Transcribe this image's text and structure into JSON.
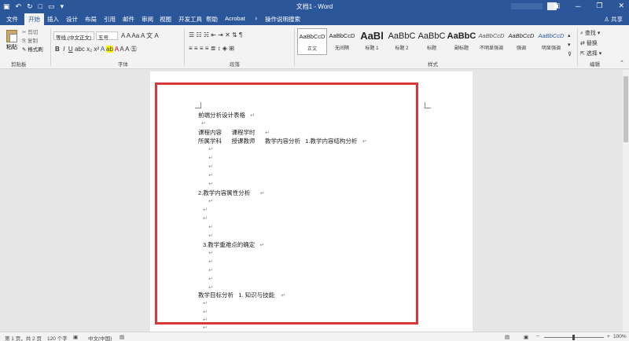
{
  "title_bar": {
    "doc_title": "文档1 - Word"
  },
  "tabs": [
    "文件",
    "开始",
    "插入",
    "设计",
    "布局",
    "引用",
    "邮件",
    "审阅",
    "视图",
    "开发工具",
    "帮助",
    "Acrobat"
  ],
  "tell_me": "操作说明搜索",
  "share": "共享",
  "ribbon": {
    "clipboard": {
      "paste": "粘贴",
      "cut": "剪切",
      "copy": "复制",
      "painter": "格式刷",
      "label": "剪贴板"
    },
    "font": {
      "family": "等线 (中文正文)",
      "size": "五号",
      "label": "字体"
    },
    "paragraph": {
      "label": "段落"
    },
    "styles": {
      "label": "样式",
      "items": [
        {
          "sample": "AaBbCcD",
          "name": "正文"
        },
        {
          "sample": "AaBbCcD",
          "name": "无间隔"
        },
        {
          "sample": "AaBl",
          "name": "标题 1"
        },
        {
          "sample": "AaBbC",
          "name": "标题 2"
        },
        {
          "sample": "AaBbC",
          "name": "标题"
        },
        {
          "sample": "AaBbC",
          "name": "副标题"
        },
        {
          "sample": "AaBbCcD",
          "name": "不明显强调"
        },
        {
          "sample": "AaBbCcD",
          "name": "强调"
        },
        {
          "sample": "AaBbCcD",
          "name": "明显强调"
        }
      ]
    },
    "editing": {
      "find": "查找",
      "replace": "替换",
      "select": "选择",
      "label": "编辑"
    }
  },
  "document": {
    "line1": "前端分析设计表格",
    "line2a": "课程内容",
    "line2b": "课程学时",
    "line3a": "所属学科",
    "line3b": "授课教师",
    "line3c": "教学内容分析",
    "line3d": "1.教学内容结构分析",
    "line4": "2.教学内容属性分析",
    "line5": "3.教学重难点的确定",
    "line6a": "教学目标分析",
    "line6b": "1. 知识与技能",
    "para_mark": "↵"
  },
  "status": {
    "page": "第 1 页，共 2 页",
    "words": "120 个字",
    "lang": "中文(中国)",
    "zoom": "100%"
  }
}
